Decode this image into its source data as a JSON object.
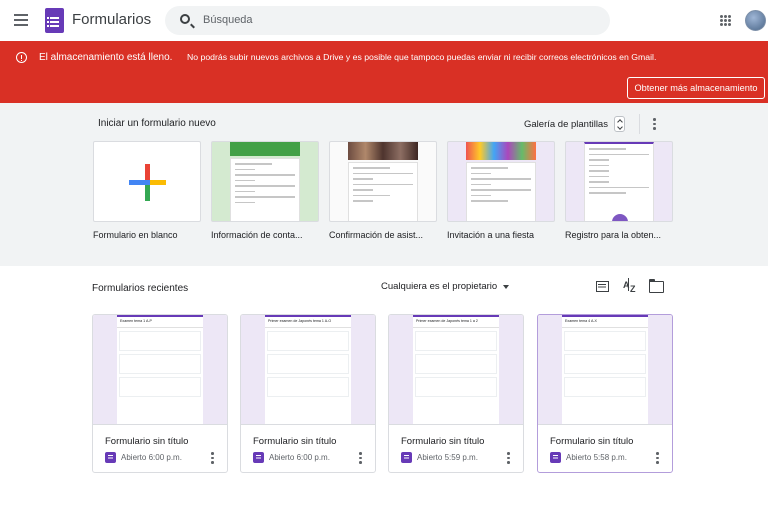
{
  "header": {
    "app_title": "Formularios",
    "search_placeholder": "Búsqueda"
  },
  "banner": {
    "title": "El almacenamiento está lleno.",
    "message": "No podrás subir nuevos archivos a Drive y es posible que tampoco puedas enviar ni recibir correos electrónicos en Gmail.",
    "button": "Obtener más almacenamiento",
    "color": "#d93025"
  },
  "templates_section": {
    "title": "Iniciar un formulario nuevo",
    "gallery_label": "Galería de plantillas",
    "items": [
      {
        "label": "Formulario en blanco",
        "icon": "plus-icon"
      },
      {
        "label": "Información de conta...",
        "accent": "#43a047"
      },
      {
        "label": "Confirmación de asist...",
        "accent": "#5d4037"
      },
      {
        "label": "Invitación a una fiesta",
        "accent": "#7e57c2"
      },
      {
        "label": "Registro para la obten...",
        "accent": "#673ab7"
      }
    ]
  },
  "recent_section": {
    "title": "Formularios recientes",
    "owner_filter": "Cualquiera es el propietario",
    "docs": [
      {
        "name": "Formulario sin título",
        "meta": "Abierto 6:00 p.m.",
        "thumb_title": "Examen tema 1 A-P"
      },
      {
        "name": "Formulario sin título",
        "meta": "Abierto 6:00 p.m.",
        "thumb_title": "Primer examen de Japonés tema 1 A-O"
      },
      {
        "name": "Formulario sin título",
        "meta": "Abierto 5:59 p.m.",
        "thumb_title": "Primer examen de Japonés tema 1 a 2"
      },
      {
        "name": "Formulario sin título",
        "meta": "Abierto 5:58 p.m.",
        "thumb_title": "Examen tema 4 A-X"
      }
    ]
  },
  "colors": {
    "forms_purple": "#673ab7",
    "template_bg": "#f1f3f4"
  }
}
